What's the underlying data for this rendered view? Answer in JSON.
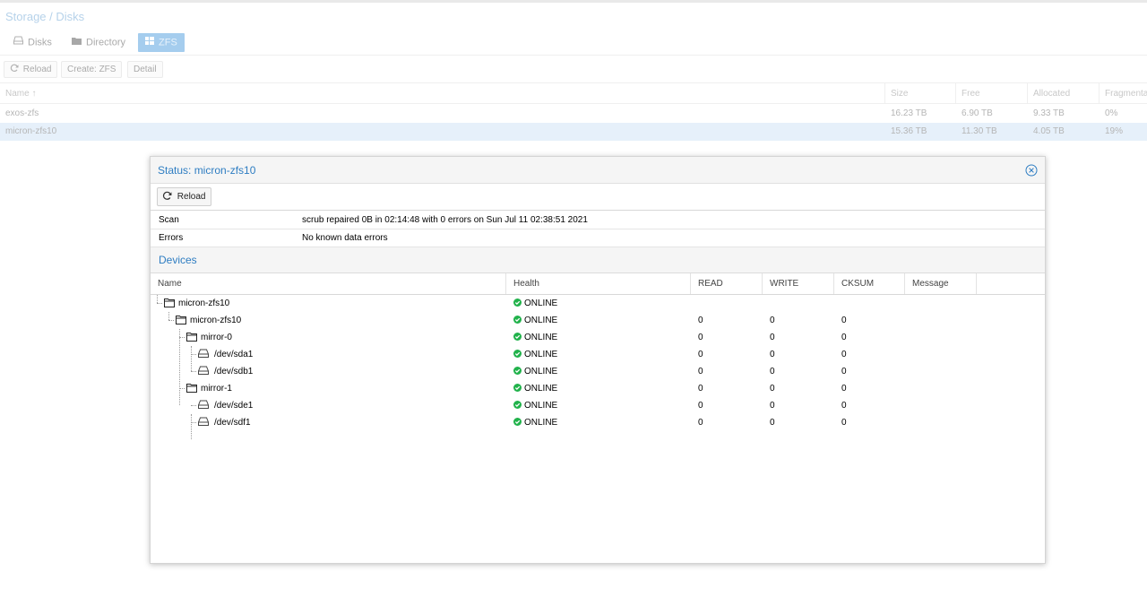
{
  "background": {
    "title": "Storage / Disks",
    "tabs": [
      {
        "label": "Disks",
        "icon": "disk-icon"
      },
      {
        "label": "Directory",
        "icon": "folder-icon"
      },
      {
        "label": "ZFS",
        "icon": "zfs-grid-icon",
        "active": true
      }
    ],
    "toolbar": {
      "reload": "Reload",
      "create": "Create: ZFS",
      "detail": "Detail"
    },
    "columns": [
      "Name",
      "Size",
      "Free",
      "Allocated",
      "Fragmenta"
    ],
    "sort_indicator": "↑",
    "pools": [
      {
        "name": "exos-zfs",
        "size": "16.23 TB",
        "free": "6.90 TB",
        "allocated": "9.33 TB",
        "frag": "0%"
      },
      {
        "name": "micron-zfs10",
        "size": "15.36 TB",
        "free": "11.30 TB",
        "allocated": "4.05 TB",
        "frag": "19%",
        "selected": true
      }
    ]
  },
  "window": {
    "title": "Status: micron-zfs10",
    "reload": "Reload",
    "scan_label": "Scan",
    "scan_value": "scrub repaired 0B in 02:14:48 with 0 errors on Sun Jul 11 02:38:51 2021",
    "errors_label": "Errors",
    "errors_value": "No known data errors",
    "devices_title": "Devices",
    "columns": [
      "Name",
      "Health",
      "READ",
      "WRITE",
      "CKSUM",
      "Message"
    ],
    "devices": [
      {
        "name": "micron-zfs10",
        "type": "pool",
        "depth": 0,
        "health": "ONLINE",
        "read": "",
        "write": "",
        "cksum": ""
      },
      {
        "name": "micron-zfs10",
        "type": "pool",
        "depth": 1,
        "health": "ONLINE",
        "read": "0",
        "write": "0",
        "cksum": "0"
      },
      {
        "name": "mirror-0",
        "type": "vdev",
        "depth": 2,
        "health": "ONLINE",
        "read": "0",
        "write": "0",
        "cksum": "0"
      },
      {
        "name": "/dev/sda1",
        "type": "disk",
        "depth": 3,
        "health": "ONLINE",
        "read": "0",
        "write": "0",
        "cksum": "0"
      },
      {
        "name": "/dev/sdb1",
        "type": "disk",
        "depth": 3,
        "health": "ONLINE",
        "read": "0",
        "write": "0",
        "cksum": "0"
      },
      {
        "name": "mirror-1",
        "type": "vdev",
        "depth": 2,
        "health": "ONLINE",
        "read": "0",
        "write": "0",
        "cksum": "0"
      },
      {
        "name": "/dev/sde1",
        "type": "disk",
        "depth": 3,
        "health": "ONLINE",
        "read": "0",
        "write": "0",
        "cksum": "0"
      },
      {
        "name": "/dev/sdf1",
        "type": "disk",
        "depth": 3,
        "health": "ONLINE",
        "read": "0",
        "write": "0",
        "cksum": "0"
      }
    ]
  },
  "colors": {
    "accent": "#2e7dc2",
    "online": "#21b24b",
    "selected_row": "#e6f0fa",
    "active_tab": "#a5cdee"
  }
}
